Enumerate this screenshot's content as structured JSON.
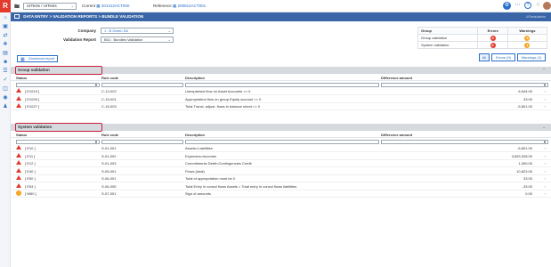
{
  "topbar": {
    "logo": "R",
    "entity": "UITests / UITests",
    "current_label": "Current",
    "current_value": "201312ACT000",
    "reference_label": "Reference",
    "reference_value": "200812ACT001"
  },
  "header": {
    "title": "DATA ENTRY > VALIDATION REPORTS > BUNDLE VALIDATION",
    "user": "UITests/admin"
  },
  "form": {
    "company_label": "Company",
    "company_value": "1 : B Green SA",
    "report_label": "Validation Report",
    "report_value": "B01 : Bundles Validation"
  },
  "summary": {
    "headers": [
      "Group",
      "Errors",
      "Warnings"
    ],
    "rows": [
      {
        "group": "Group validation",
        "errors": "3",
        "warnings": "0"
      },
      {
        "group": "System validation",
        "errors": "6",
        "warnings": "1"
      }
    ]
  },
  "download_label": "Download report",
  "filters": {
    "all": "All",
    "errors": "Errors (9)",
    "warnings": "Warnings (1)"
  },
  "columns": {
    "status": "Status",
    "rule": "Rule code",
    "description": "Description",
    "amount": "Difference amount"
  },
  "group_validation": {
    "title": "Group validation",
    "rows": [
      {
        "status": "[ E1019 ]",
        "rule": "C-12-002",
        "description": "Unexplained flow on Asset Accounts <> 0",
        "amount": "6,644.00",
        "level": "error"
      },
      {
        "status": "[ E1026 ]",
        "rule": "C-15-001",
        "description": "Appropriation flow on group Equity account <> 0",
        "amount": "33.00",
        "level": "error"
      },
      {
        "status": "[ E1027 ]",
        "rule": "C-15-003",
        "description": "Total Transl. adjust. flows in balance sheet <> 0",
        "amount": "-5,801.00",
        "level": "error"
      }
    ]
  },
  "system_validation": {
    "title": "System validation",
    "rows": [
      {
        "status": "[ E10 ]",
        "rule": "S-01-001",
        "description": "Assets=Liabilities",
        "amount": "-5,801.00",
        "level": "error"
      },
      {
        "status": "[ E11 ]",
        "rule": "S-01-002",
        "description": "Expenses=Incomes",
        "amount": "3,653,328.00",
        "level": "error"
      },
      {
        "status": "[ E12 ]",
        "rule": "S-01-003",
        "description": "Commitments Debit=Contingencies Credit",
        "amount": "1,000.00",
        "level": "error"
      },
      {
        "status": "[ E40 ]",
        "rule": "S-05-001",
        "description": "Flows (total)",
        "amount": "10,823.00",
        "level": "error"
      },
      {
        "status": "[ E50 ]",
        "rule": "S-06-001",
        "description": "Total of appropriation must be 0",
        "amount": "33.00",
        "level": "error"
      },
      {
        "status": "[ E54 ]",
        "rule": "S-06-005",
        "description": "Total Entry in consol flows Assets = Total entry in consol flows liabilities",
        "amount": "-33.00",
        "level": "error"
      },
      {
        "status": "[ W60 ]",
        "rule": "S-07-001",
        "description": "Sign of amounts",
        "amount": "0.00",
        "level": "warning"
      }
    ]
  },
  "colors": {
    "accent": "#3a66a8",
    "error": "#e23a2e",
    "warning": "#f5a623",
    "highlight": "#c7203a"
  }
}
